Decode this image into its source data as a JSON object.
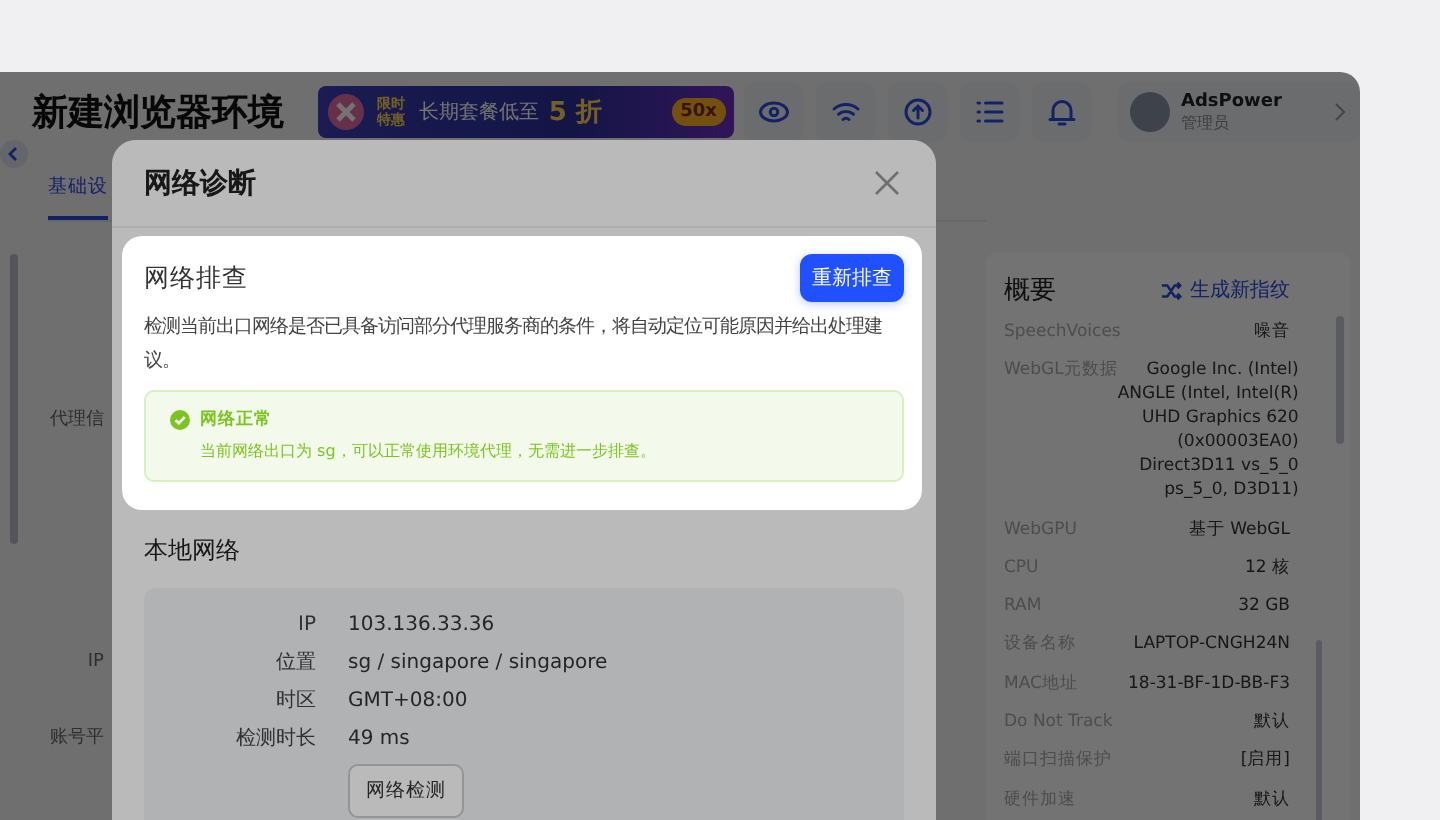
{
  "app": {
    "title": "新建浏览器环境",
    "promo": {
      "tag": "限时特惠",
      "text": "长期套餐低至",
      "discount": "5 折",
      "badge": "50x"
    },
    "user": {
      "name": "AdsPower",
      "role": "管理员"
    },
    "tabs": [
      {
        "label": "基础设",
        "selected": true
      }
    ],
    "form_labels": [
      "代理信",
      "IP",
      "账号平"
    ]
  },
  "summary": {
    "title": "概要",
    "action": "生成新指纹",
    "rows": [
      {
        "key": "SpeechVoices",
        "value": "噪音"
      },
      {
        "key": "WebGL元数据",
        "value_lines": [
          "Google Inc. (Intel)",
          "ANGLE (Intel, Intel(R)",
          "UHD Graphics 620",
          "(0x00003EA0)",
          "Direct3D11 vs_5_0",
          "ps_5_0, D3D11)"
        ]
      },
      {
        "key": "WebGPU",
        "value": "基于 WebGL"
      },
      {
        "key": "CPU",
        "value": "12 核"
      },
      {
        "key": "RAM",
        "value": "32 GB"
      },
      {
        "key": "设备名称",
        "value": "LAPTOP-CNGH24N"
      },
      {
        "key": "MAC地址",
        "value": "18-31-BF-1D-BB-F3"
      },
      {
        "key": "Do Not Track",
        "value": "默认"
      },
      {
        "key": "端口扫描保护",
        "value": "[启用]"
      },
      {
        "key": "硬件加速",
        "value": "默认"
      }
    ]
  },
  "modal": {
    "title": "网络诊断",
    "check": {
      "title": "网络排查",
      "button": "重新排查",
      "description": "检测当前出口网络是否已具备访问部分代理服务商的条件，将自动定位可能原因并给出处理建议。",
      "result": {
        "kind": "success",
        "title": "网络正常",
        "message": "当前网络出口为 sg，可以正常使用环境代理，无需进一步排查。"
      }
    },
    "local": {
      "title": "本地网络",
      "rows": [
        {
          "label": "IP",
          "value": "103.136.33.36"
        },
        {
          "label": "位置",
          "value": "sg / singapore / singapore"
        },
        {
          "label": "时区",
          "value": "GMT+08:00"
        },
        {
          "label": "检测时长",
          "value": "49 ms"
        }
      ],
      "button": "网络检测"
    }
  }
}
